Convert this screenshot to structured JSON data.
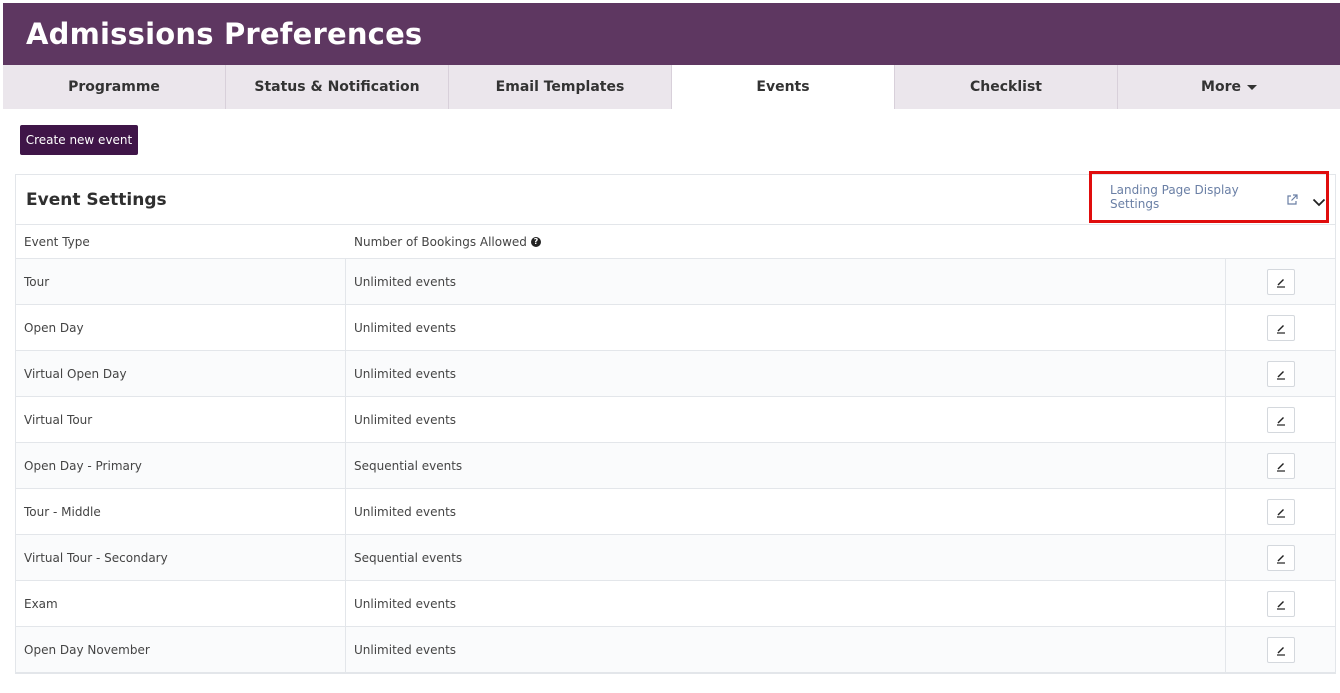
{
  "page": {
    "title": "Admissions Preferences"
  },
  "tabs": [
    {
      "label": "Programme"
    },
    {
      "label": "Status & Notification"
    },
    {
      "label": "Email Templates"
    },
    {
      "label": "Events",
      "active": true
    },
    {
      "label": "Checklist"
    },
    {
      "label": "More"
    }
  ],
  "actions": {
    "create_event_label": "Create new event"
  },
  "settings": {
    "title": "Event Settings",
    "landing_link_label": "Landing Page Display Settings",
    "columns": {
      "type": "Event Type",
      "bookings": "Number of Bookings Allowed"
    },
    "rows": [
      {
        "type": "Tour",
        "bookings": "Unlimited events"
      },
      {
        "type": "Open Day",
        "bookings": "Unlimited events"
      },
      {
        "type": "Virtual Open Day",
        "bookings": "Unlimited events"
      },
      {
        "type": "Virtual Tour",
        "bookings": "Unlimited events"
      },
      {
        "type": "Open Day - Primary",
        "bookings": "Sequential events"
      },
      {
        "type": "Tour - Middle",
        "bookings": "Unlimited events"
      },
      {
        "type": "Virtual Tour - Secondary",
        "bookings": "Sequential events"
      },
      {
        "type": "Exam",
        "bookings": "Unlimited events"
      },
      {
        "type": "Open Day November",
        "bookings": "Unlimited events"
      }
    ]
  },
  "colors": {
    "header_bg": "#5e3761",
    "button_bg": "#3f1548",
    "highlight": "#e00d0d",
    "link": "#6a7fa5"
  },
  "icons": {
    "external": "external-link-icon",
    "chevron": "chevron-down-icon",
    "help": "question-circle-icon",
    "edit": "pencil-icon"
  }
}
